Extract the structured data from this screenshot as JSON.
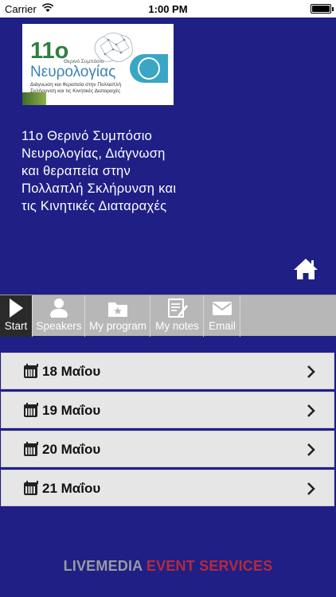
{
  "status_bar": {
    "carrier": "Carrier",
    "time": "1:00 PM"
  },
  "banner": {
    "number": "11o",
    "symposium": "Θερινό Συμπόσιο",
    "title": "Νευρολογίας",
    "subtitle_line1": "Διάγνωση και θεραπεία στην Πολλαπλή",
    "subtitle_line2": "Σκλήρυνση και τις Κινητικές Διαταραχές"
  },
  "event_title": "11o Θερινό Συμπόσιο Νευρολογίας, Διάγνωση και θεραπεία στην Πολλαπλή Σκλήρυνση και τις Κινητικές Διαταραχές",
  "tabs": [
    {
      "label": "Start",
      "icon": "play-icon"
    },
    {
      "label": "Speakers",
      "icon": "speaker-icon"
    },
    {
      "label": "My program",
      "icon": "folder-star-icon"
    },
    {
      "label": "My notes",
      "icon": "notes-icon"
    },
    {
      "label": "Email",
      "icon": "envelope-icon"
    }
  ],
  "days": [
    {
      "label": "18 Μαΐου"
    },
    {
      "label": "19 Μαΐου"
    },
    {
      "label": "20 Μαΐου"
    },
    {
      "label": "21 Μαΐου"
    }
  ],
  "footer": {
    "part1": "LIVEMEDIA",
    "part2": "EVENT SERVICES"
  },
  "colors": {
    "background": "#1f1f86",
    "tab_active": "#2a2a2a",
    "tab_bar": "#b7b7b7",
    "footer_accent": "#b52a3a"
  }
}
